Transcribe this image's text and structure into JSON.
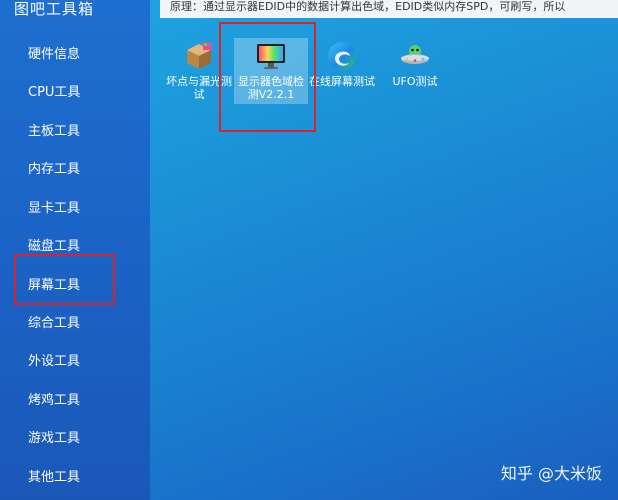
{
  "app": {
    "title": "图吧工具箱"
  },
  "info_bar": {
    "text": "原理：通过显示器EDID中的数据计算出色域，EDID类似内存SPD，可刷写，所以"
  },
  "sidebar": {
    "items": [
      {
        "label": "硬件信息"
      },
      {
        "label": "CPU工具"
      },
      {
        "label": "主板工具"
      },
      {
        "label": "内存工具"
      },
      {
        "label": "显卡工具"
      },
      {
        "label": "磁盘工具"
      },
      {
        "label": "屏幕工具"
      },
      {
        "label": "综合工具"
      },
      {
        "label": "外设工具"
      },
      {
        "label": "烤鸡工具"
      },
      {
        "label": "游戏工具"
      },
      {
        "label": "其他工具"
      }
    ],
    "selected": "屏幕工具"
  },
  "tools": [
    {
      "label": "坏点与漏光测试",
      "icon": "box-icon"
    },
    {
      "label": "显示器色域检测V2.2.1",
      "icon": "monitor-icon"
    },
    {
      "label": "在线屏幕测试",
      "icon": "edge-browser-icon"
    },
    {
      "label": "UFO测试",
      "icon": "ufo-icon"
    }
  ],
  "watermark": {
    "text": "知乎 @大米饭"
  },
  "colors": {
    "highlight_border": "#d8252b",
    "sidebar_bg": "#1d6fd0",
    "main_bg": "#1b8ed6"
  }
}
